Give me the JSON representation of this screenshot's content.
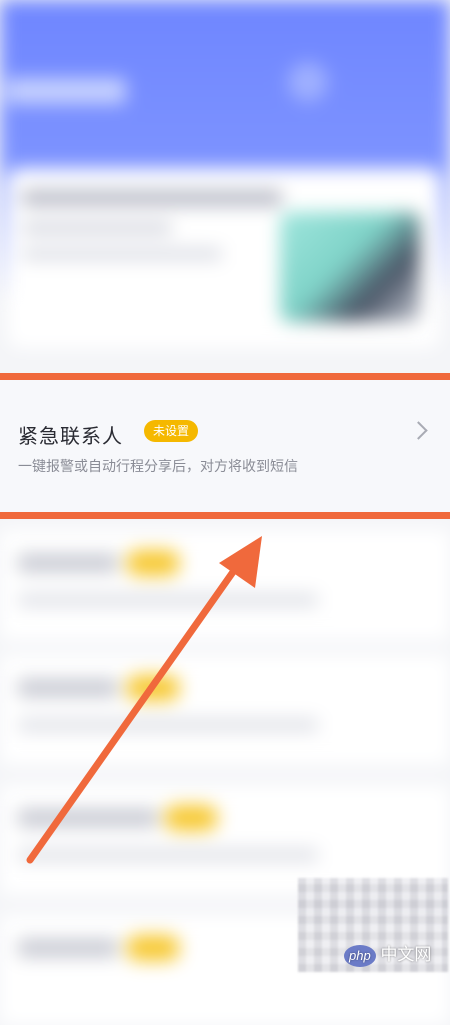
{
  "item": {
    "title": "紧急联系人",
    "badge": "未设置",
    "description": "一键报警或自动行程分享后，对方将收到短信"
  },
  "watermark": {
    "php": "php",
    "site": "中文网"
  },
  "colors": {
    "annotation": "#f0693c",
    "badge": "#f5b800",
    "header": "#6f86ff"
  }
}
